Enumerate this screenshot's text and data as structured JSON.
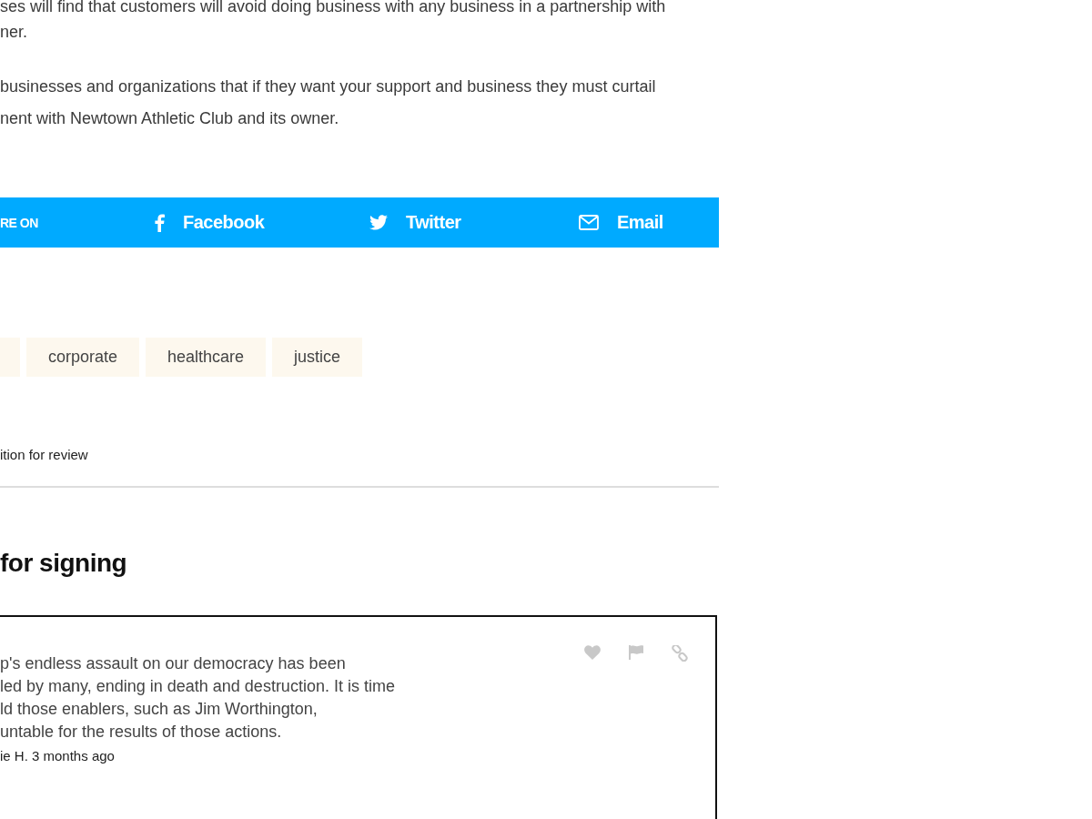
{
  "article": {
    "paragraphs": [
      {
        "lines": [
          "ses will find that customers will avoid doing business with any business in a partnership with",
          "ner."
        ]
      },
      {
        "lines": [
          "businesses and organizations that if they want your support and business they must curtail",
          "nent with Newtown Athletic Club and its owner."
        ]
      }
    ]
  },
  "share_bar": {
    "label": "RE ON",
    "links": [
      {
        "kind": "facebook",
        "label": "Facebook"
      },
      {
        "kind": "twitter",
        "label": "Twitter"
      },
      {
        "kind": "email",
        "label": "Email"
      }
    ]
  },
  "tags": [
    {
      "label": "corporate"
    },
    {
      "label": "healthcare"
    },
    {
      "label": "justice"
    }
  ],
  "petition_note": "ition for review",
  "section_heading": "for signing",
  "comment": {
    "lines": [
      "p's endless assault on our democracy has been",
      "led by many, ending in death and destruction. It is time",
      "ld those enablers, such as Jim Worthington,",
      "untable for the results of those actions."
    ],
    "meta": "ie H. 3 months ago",
    "actions": [
      {
        "kind": "heart"
      },
      {
        "kind": "flag"
      },
      {
        "kind": "link"
      }
    ]
  }
}
